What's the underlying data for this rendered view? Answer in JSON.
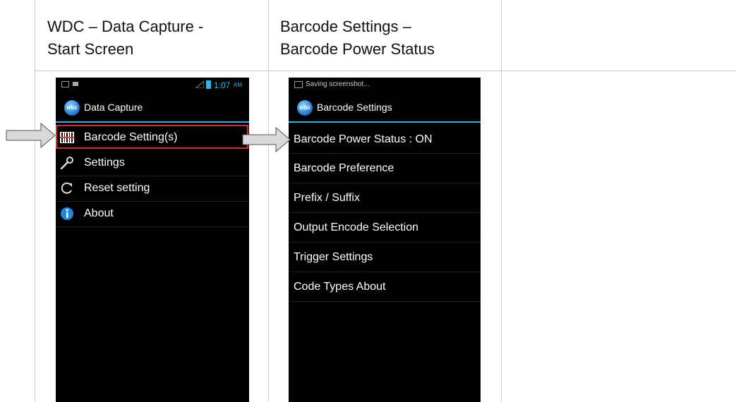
{
  "columns": [
    {
      "header": "WDC – Data Capture -\nStart Screen"
    },
    {
      "header": "Barcode Settings –\nBarcode Power Status"
    },
    {
      "header": ""
    }
  ],
  "screen1": {
    "status_time": "1:07",
    "status_ampm": "AM",
    "app_title": "Data Capture",
    "logo_text": "wbc",
    "menu": [
      {
        "label": "Barcode Setting(s)",
        "icon": "barcode-icon"
      },
      {
        "label": "Settings",
        "icon": "wrench-icon"
      },
      {
        "label": "Reset setting",
        "icon": "reset-icon"
      },
      {
        "label": "About",
        "icon": "info-icon"
      }
    ]
  },
  "screen2": {
    "status_text": "Saving screenshot...",
    "app_title": "Barcode Settings",
    "logo_text": "wbc",
    "menu": [
      {
        "label": "Barcode Power Status : ON"
      },
      {
        "label": "Barcode Preference"
      },
      {
        "label": "Prefix / Suffix"
      },
      {
        "label": "Output Encode Selection"
      },
      {
        "label": "Trigger Settings"
      },
      {
        "label": "Code Types About"
      }
    ]
  },
  "colors": {
    "accent": "#33b5e5",
    "highlight_border": "#d32f2f",
    "arrow_fill": "#d9d9d9"
  }
}
